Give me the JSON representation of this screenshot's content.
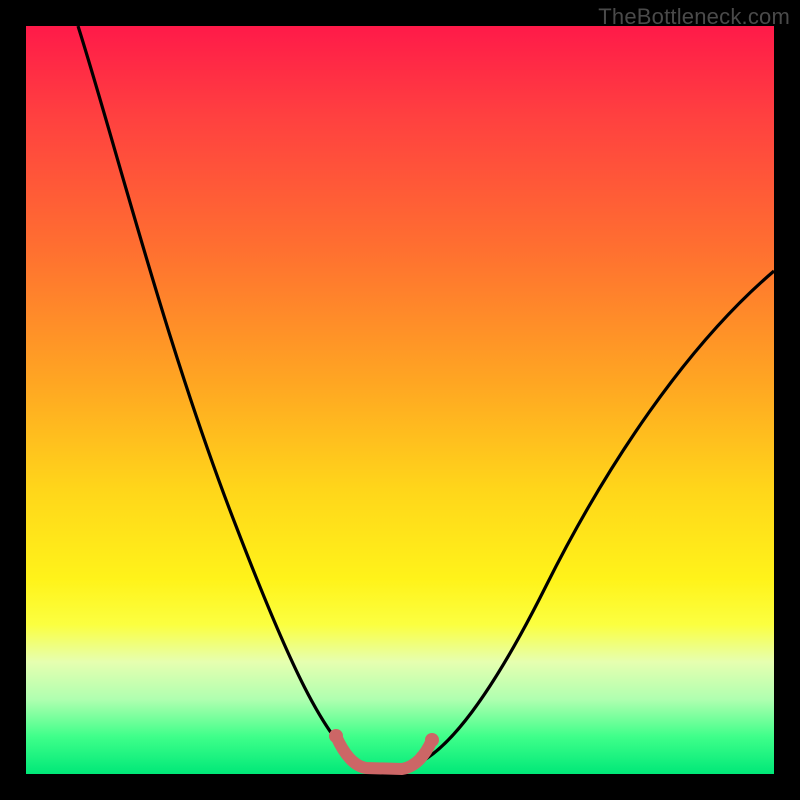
{
  "watermark": "TheBottleneck.com",
  "colors": {
    "background": "#000000",
    "curve_main": "#000000",
    "curve_highlight": "#cc6666"
  },
  "chart_data": {
    "type": "line",
    "title": "",
    "xlabel": "",
    "ylabel": "",
    "xlim": [
      0,
      100
    ],
    "ylim": [
      0,
      100
    ],
    "grid": false,
    "series": [
      {
        "name": "bottleneck-curve",
        "x": [
          7,
          10,
          15,
          20,
          25,
          30,
          35,
          40,
          42,
          44,
          46,
          48,
          50,
          55,
          60,
          65,
          70,
          75,
          80,
          85,
          90,
          95,
          100
        ],
        "y": [
          100,
          90,
          75,
          60,
          47,
          35,
          24,
          13,
          8,
          4,
          1,
          0,
          0,
          4,
          11,
          18,
          25,
          32,
          38,
          44,
          49,
          54,
          59
        ]
      }
    ],
    "highlight_segment": {
      "x": [
        42,
        44,
        46,
        48,
        50,
        52,
        54
      ],
      "y": [
        6,
        2,
        0.5,
        0,
        0,
        1.5,
        5
      ]
    }
  }
}
